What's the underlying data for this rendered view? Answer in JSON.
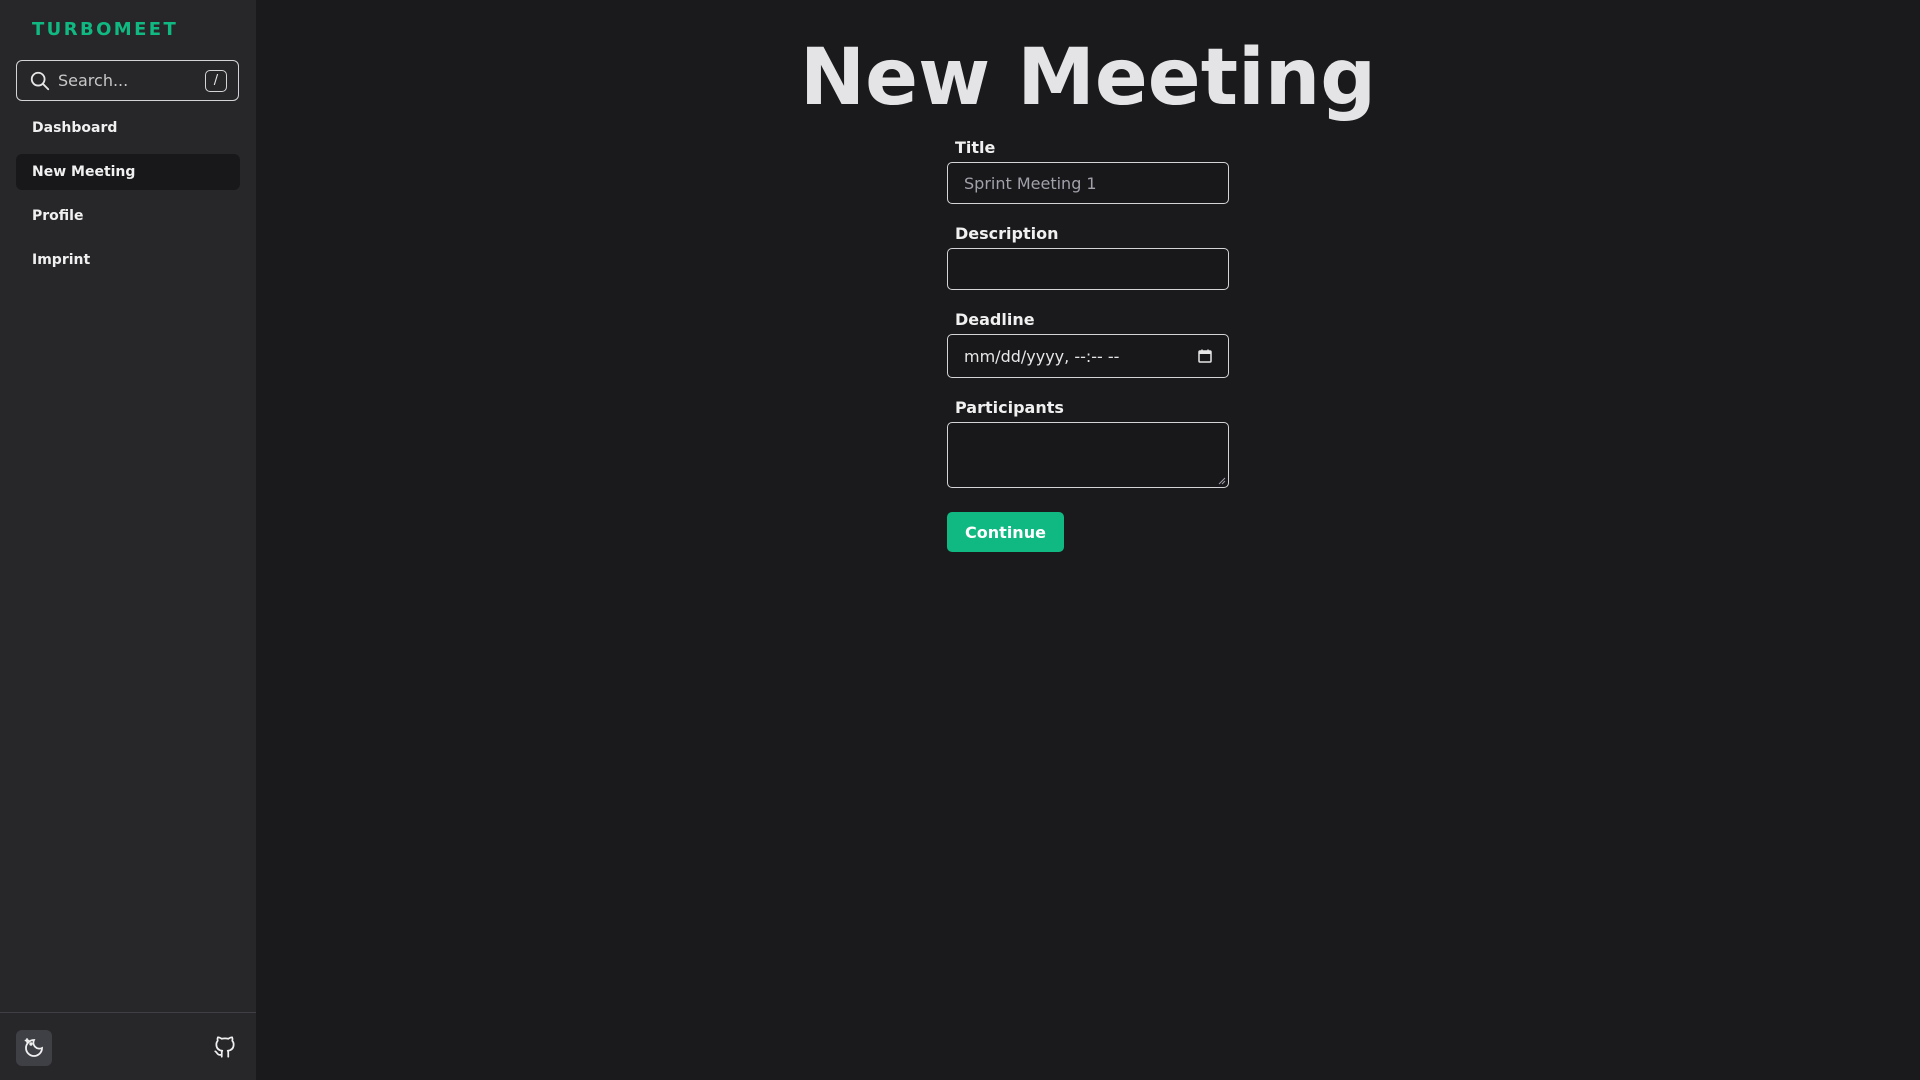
{
  "app": {
    "brand": "TURBOMEET",
    "brand_color": "#10b981"
  },
  "sidebar": {
    "search": {
      "placeholder": "Search...",
      "shortcut": "/",
      "icon": "search-icon"
    },
    "items": [
      {
        "label": "Dashboard",
        "active": false
      },
      {
        "label": "New Meeting",
        "active": true
      },
      {
        "label": "Profile",
        "active": false
      },
      {
        "label": "Imprint",
        "active": false
      }
    ],
    "footer": {
      "theme_icon": "theme-toggle-icon",
      "github_icon": "github-icon"
    }
  },
  "main": {
    "title": "New Meeting",
    "form": {
      "title": {
        "label": "Title",
        "placeholder": "Sprint Meeting 1",
        "value": ""
      },
      "description": {
        "label": "Description",
        "value": ""
      },
      "deadline": {
        "label": "Deadline",
        "display": "mm/dd/yyyy, --:-- --",
        "icon": "calendar-icon"
      },
      "participants": {
        "label": "Participants",
        "value": ""
      },
      "continue_label": "Continue"
    }
  }
}
